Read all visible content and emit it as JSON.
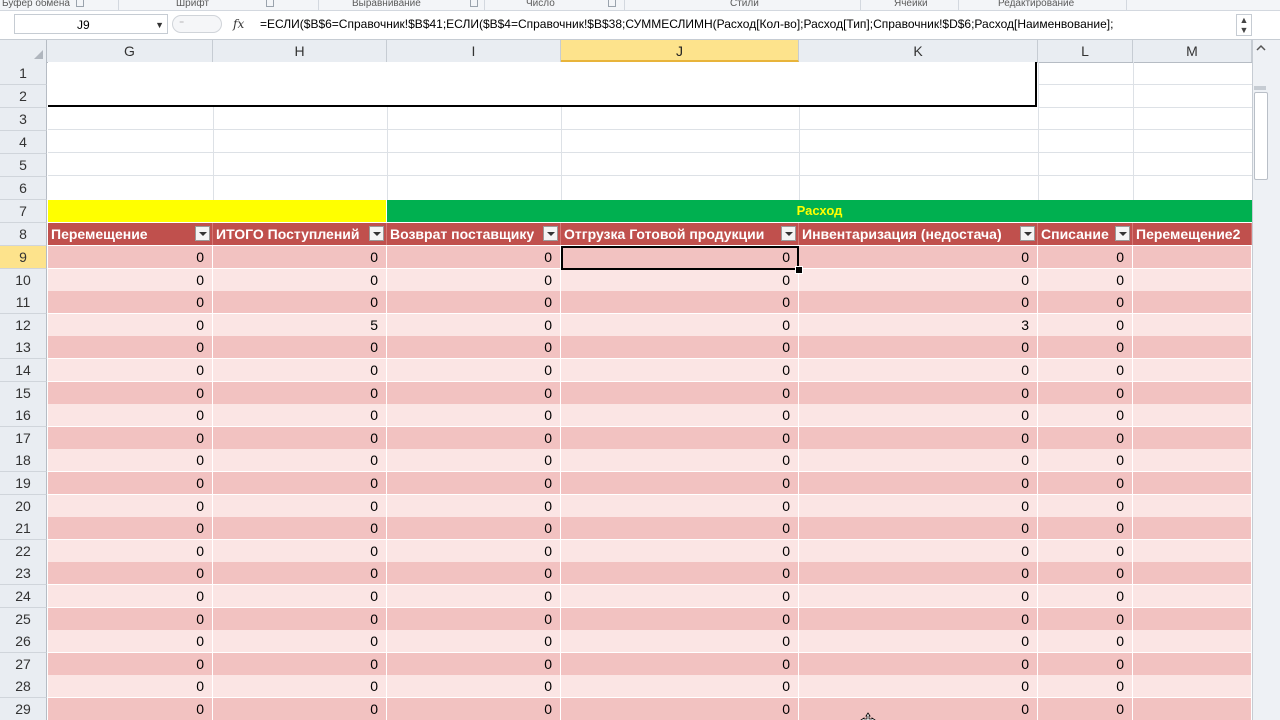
{
  "ribbon": {
    "groups": [
      {
        "label": "Буфер обмена"
      },
      {
        "label": "Шрифт"
      },
      {
        "label": "Выравнивание"
      },
      {
        "label": "Число"
      },
      {
        "label": "Стили"
      },
      {
        "label": "Ячейки"
      },
      {
        "label": "Редактирование"
      }
    ]
  },
  "formula_bar": {
    "name_box": "J9",
    "fx": "fx",
    "formula": "=ЕСЛИ($B$6=Справочник!$B$41;ЕСЛИ($B$4=Справочник!$B$38;СУММЕСЛИМН(Расход[Кол-во];Расход[Тип];Справочник!$D$6;Расход[Наименвование];"
  },
  "columns": [
    "G",
    "H",
    "I",
    "J",
    "K",
    "L",
    "M"
  ],
  "selected_column": "J",
  "rows": [
    "1",
    "2",
    "3",
    "4",
    "5",
    "6",
    "7",
    "8",
    "9",
    "10",
    "11",
    "12",
    "13",
    "14",
    "15",
    "16",
    "17",
    "18",
    "19",
    "20",
    "21",
    "22",
    "23",
    "24",
    "25",
    "26",
    "27",
    "28",
    "29"
  ],
  "selected_row": "9",
  "group_header": {
    "expense": "Расход"
  },
  "table_headers": [
    "Перемещение",
    "ИТОГО Поступлений",
    "Возврат поставщику",
    "Отгрузка Готовой продукции",
    "Инвентаризация (недостача)",
    "Списание",
    "Перемещение2"
  ],
  "data_rows": [
    {
      "row": "9",
      "values": [
        "0",
        "0",
        "0",
        "0",
        "0",
        "0",
        ""
      ]
    },
    {
      "row": "10",
      "values": [
        "0",
        "0",
        "0",
        "0",
        "0",
        "0",
        ""
      ]
    },
    {
      "row": "11",
      "values": [
        "0",
        "0",
        "0",
        "0",
        "0",
        "0",
        ""
      ]
    },
    {
      "row": "12",
      "values": [
        "0",
        "5",
        "0",
        "0",
        "3",
        "0",
        ""
      ]
    },
    {
      "row": "13",
      "values": [
        "0",
        "0",
        "0",
        "0",
        "0",
        "0",
        ""
      ]
    },
    {
      "row": "14",
      "values": [
        "0",
        "0",
        "0",
        "0",
        "0",
        "0",
        ""
      ]
    },
    {
      "row": "15",
      "values": [
        "0",
        "0",
        "0",
        "0",
        "0",
        "0",
        ""
      ]
    },
    {
      "row": "16",
      "values": [
        "0",
        "0",
        "0",
        "0",
        "0",
        "0",
        ""
      ]
    },
    {
      "row": "17",
      "values": [
        "0",
        "0",
        "0",
        "0",
        "0",
        "0",
        ""
      ]
    },
    {
      "row": "18",
      "values": [
        "0",
        "0",
        "0",
        "0",
        "0",
        "0",
        ""
      ]
    },
    {
      "row": "19",
      "values": [
        "0",
        "0",
        "0",
        "0",
        "0",
        "0",
        ""
      ]
    },
    {
      "row": "20",
      "values": [
        "0",
        "0",
        "0",
        "0",
        "0",
        "0",
        ""
      ]
    },
    {
      "row": "21",
      "values": [
        "0",
        "0",
        "0",
        "0",
        "0",
        "0",
        ""
      ]
    },
    {
      "row": "22",
      "values": [
        "0",
        "0",
        "0",
        "0",
        "0",
        "0",
        ""
      ]
    },
    {
      "row": "23",
      "values": [
        "0",
        "0",
        "0",
        "0",
        "0",
        "0",
        ""
      ]
    },
    {
      "row": "24",
      "values": [
        "0",
        "0",
        "0",
        "0",
        "0",
        "0",
        ""
      ]
    },
    {
      "row": "25",
      "values": [
        "0",
        "0",
        "0",
        "0",
        "0",
        "0",
        ""
      ]
    },
    {
      "row": "26",
      "values": [
        "0",
        "0",
        "0",
        "0",
        "0",
        "0",
        ""
      ]
    },
    {
      "row": "27",
      "values": [
        "0",
        "0",
        "0",
        "0",
        "0",
        "0",
        ""
      ]
    },
    {
      "row": "28",
      "values": [
        "0",
        "0",
        "0",
        "0",
        "0",
        "0",
        ""
      ]
    },
    {
      "row": "29",
      "values": [
        "0",
        "0",
        "0",
        "0",
        "0",
        "0",
        ""
      ]
    }
  ],
  "colors": {
    "header_red": "#c0504d",
    "row_odd": "#f2c2c1",
    "row_even": "#fbe5e4",
    "group_yellow": "#ffff00",
    "group_green": "#00b050",
    "selection": "#fde38c"
  }
}
